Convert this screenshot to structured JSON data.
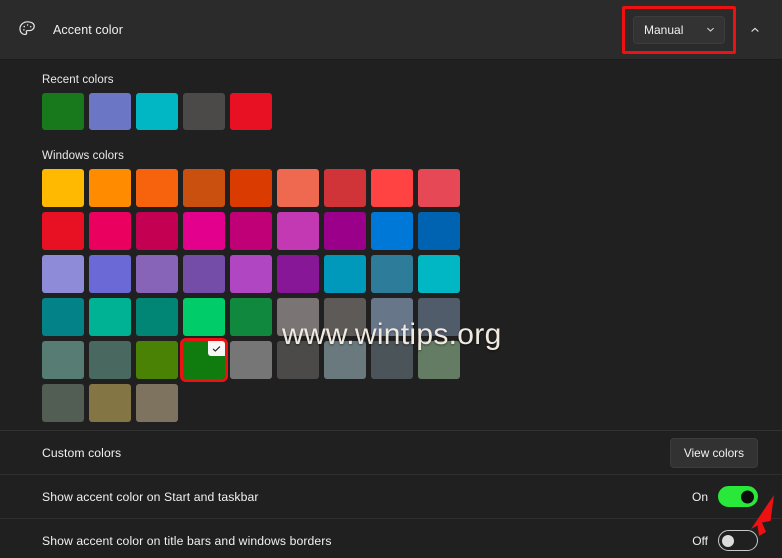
{
  "header": {
    "icon": "palette-icon",
    "title": "Accent color",
    "dropdown": {
      "value": "Manual",
      "chevron_icon": "chevron-down-icon",
      "highlight_color": "#ee1111"
    },
    "collapse_icon": "chevron-up-icon"
  },
  "recent": {
    "label": "Recent colors",
    "colors": [
      "#17791b",
      "#6b77c4",
      "#00b7c3",
      "#4c4a48",
      "#e81123"
    ]
  },
  "windows": {
    "label": "Windows colors",
    "selected_index": 39,
    "selected_color": "#107c10",
    "colors": [
      "#ffb900",
      "#ff8c00",
      "#f7630c",
      "#ca5010",
      "#da3b01",
      "#ef6950",
      "#d13438",
      "#ff4343",
      "#e74856",
      "#e81123",
      "#ea005e",
      "#c30052",
      "#e3008c",
      "#bf0077",
      "#c239b3",
      "#9a0089",
      "#0078d7",
      "#0063b1",
      "#8e8cd8",
      "#6b69d6",
      "#8764b8",
      "#744da9",
      "#b146c2",
      "#881798",
      "#0099bc",
      "#2d7d9a",
      "#00b7c3",
      "#038387",
      "#00b294",
      "#018574",
      "#00cc6a",
      "#10893e",
      "#7a7574",
      "#5d5a58",
      "#68768a",
      "#515c6b",
      "#567c73",
      "#486860",
      "#498205",
      "#107c10",
      "#767676",
      "#4c4a48",
      "#69797e",
      "#4a5459",
      "#647c64",
      "#525e54",
      "#847545",
      "#7e735f"
    ]
  },
  "watermark": {
    "text": "www.wintips.org"
  },
  "custom": {
    "label": "Custom colors",
    "button_label": "View colors"
  },
  "settings": [
    {
      "label": "Show accent color on Start and taskbar",
      "state": "On",
      "on": true,
      "toggle_color": "#2ae83a"
    },
    {
      "label": "Show accent color on title bars and windows borders",
      "state": "Off",
      "on": false,
      "toggle_color": "#c9c9c9"
    }
  ],
  "annotation": {
    "arrow_color": "#ee1111"
  }
}
